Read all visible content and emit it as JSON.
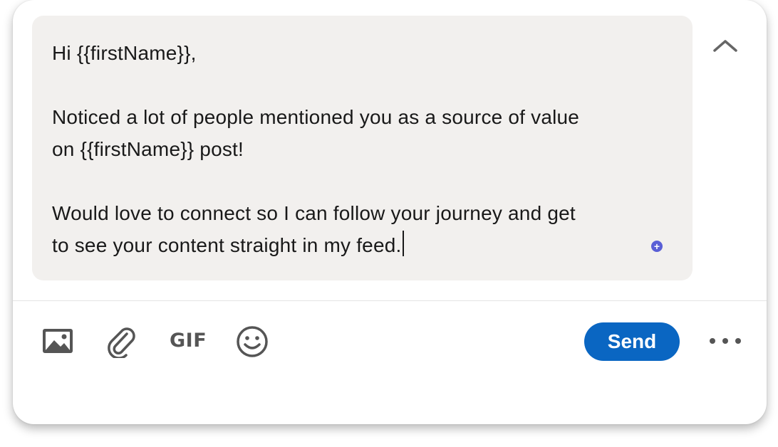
{
  "message": {
    "lines": [
      "Hi {{firstName}},",
      "",
      "Noticed a lot of people mentioned you as a source of value",
      "on {{firstName}} post!",
      "",
      "Would love to connect so I can follow your journey and get",
      "to see your content straight in my feed."
    ]
  },
  "toolbar": {
    "gif_label": "GIF",
    "send_label": "Send"
  },
  "icons": {
    "collapse": "chevron-up-icon",
    "image": "image-icon",
    "attach": "paperclip-icon",
    "emoji": "emoji-icon",
    "more": "more-horizontal-icon",
    "plus": "plus-circle-icon"
  },
  "colors": {
    "accent": "#0a66c2",
    "compose_bg": "#f2f0ee",
    "plus_badge": "#5a5fd6"
  }
}
